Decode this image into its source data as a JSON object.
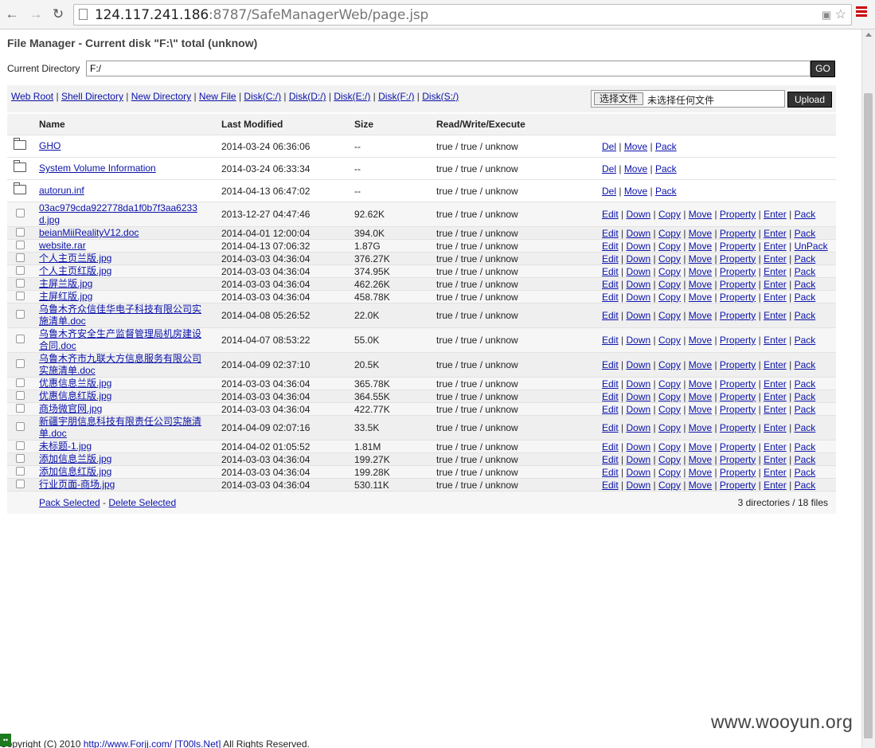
{
  "browser": {
    "url_host": "124.117.241.186",
    "url_rest": ":8787/SafeManagerWeb/page.jsp"
  },
  "page": {
    "title": "File Manager - Current disk \"F:\\\" total (unknow)",
    "current_directory_label": "Current Directory",
    "current_directory_value": "F:/",
    "go_label": "GO",
    "nav_links": [
      "Web Root",
      "Shell Directory",
      "New Directory",
      "New File",
      "Disk(C:/)",
      "Disk(D:/)",
      "Disk(E:/)",
      "Disk(F:/)",
      "Disk(S:/)"
    ],
    "choose_file_label": "选择文件",
    "no_file_label": "未选择任何文件",
    "upload_label": "Upload",
    "columns": [
      "Name",
      "Last Modified",
      "Size",
      "Read/Write/Execute"
    ],
    "directories": [
      {
        "name": "GHO",
        "modified": "2014-03-24 06:36:06",
        "size": "--",
        "rwx": "true / true / unknow",
        "actions": [
          "Del",
          "Move",
          "Pack"
        ]
      },
      {
        "name": "System Volume Information",
        "modified": "2014-03-24 06:33:34",
        "size": "--",
        "rwx": "true / true / unknow",
        "actions": [
          "Del",
          "Move",
          "Pack"
        ]
      },
      {
        "name": "autorun.inf",
        "modified": "2014-04-13 06:47:02",
        "size": "--",
        "rwx": "true / true / unknow",
        "actions": [
          "Del",
          "Move",
          "Pack"
        ]
      }
    ],
    "files": [
      {
        "name": "03ac979cda922778da1f0b7f3aa6233d.jpg",
        "modified": "2013-12-27 04:47:46",
        "size": "92.62K",
        "rwx": "true / true / unknow",
        "actions": [
          "Edit",
          "Down",
          "Copy",
          "Move",
          "Property",
          "Enter",
          "Pack"
        ]
      },
      {
        "name": "beianMiiRealityV12.doc",
        "modified": "2014-04-01 12:00:04",
        "size": "394.0K",
        "rwx": "true / true / unknow",
        "actions": [
          "Edit",
          "Down",
          "Copy",
          "Move",
          "Property",
          "Enter",
          "Pack"
        ]
      },
      {
        "name": "website.rar",
        "modified": "2014-04-13 07:06:32",
        "size": "1.87G",
        "rwx": "true / true / unknow",
        "actions": [
          "Edit",
          "Down",
          "Copy",
          "Move",
          "Property",
          "Enter",
          "UnPack"
        ]
      },
      {
        "name": "个人主页兰版.jpg",
        "modified": "2014-03-03 04:36:04",
        "size": "376.27K",
        "rwx": "true / true / unknow",
        "actions": [
          "Edit",
          "Down",
          "Copy",
          "Move",
          "Property",
          "Enter",
          "Pack"
        ]
      },
      {
        "name": "个人主页红版.jpg",
        "modified": "2014-03-03 04:36:04",
        "size": "374.95K",
        "rwx": "true / true / unknow",
        "actions": [
          "Edit",
          "Down",
          "Copy",
          "Move",
          "Property",
          "Enter",
          "Pack"
        ]
      },
      {
        "name": "主屏兰版.jpg",
        "modified": "2014-03-03 04:36:04",
        "size": "462.26K",
        "rwx": "true / true / unknow",
        "actions": [
          "Edit",
          "Down",
          "Copy",
          "Move",
          "Property",
          "Enter",
          "Pack"
        ]
      },
      {
        "name": "主屏红版.jpg",
        "modified": "2014-03-03 04:36:04",
        "size": "458.78K",
        "rwx": "true / true / unknow",
        "actions": [
          "Edit",
          "Down",
          "Copy",
          "Move",
          "Property",
          "Enter",
          "Pack"
        ]
      },
      {
        "name": "乌鲁木齐众信佳华电子科技有限公司实施清单.doc",
        "modified": "2014-04-08 05:26:52",
        "size": "22.0K",
        "rwx": "true / true / unknow",
        "actions": [
          "Edit",
          "Down",
          "Copy",
          "Move",
          "Property",
          "Enter",
          "Pack"
        ]
      },
      {
        "name": "乌鲁木齐安全生产监督管理局机房建设合同.doc",
        "modified": "2014-04-07 08:53:22",
        "size": "55.0K",
        "rwx": "true / true / unknow",
        "actions": [
          "Edit",
          "Down",
          "Copy",
          "Move",
          "Property",
          "Enter",
          "Pack"
        ]
      },
      {
        "name": "乌鲁木齐市九联大方信息服务有限公司实施清单.doc",
        "modified": "2014-04-09 02:37:10",
        "size": "20.5K",
        "rwx": "true / true / unknow",
        "actions": [
          "Edit",
          "Down",
          "Copy",
          "Move",
          "Property",
          "Enter",
          "Pack"
        ]
      },
      {
        "name": "优惠信息兰版.jpg",
        "modified": "2014-03-03 04:36:04",
        "size": "365.78K",
        "rwx": "true / true / unknow",
        "actions": [
          "Edit",
          "Down",
          "Copy",
          "Move",
          "Property",
          "Enter",
          "Pack"
        ]
      },
      {
        "name": "优惠信息红版.jpg",
        "modified": "2014-03-03 04:36:04",
        "size": "364.55K",
        "rwx": "true / true / unknow",
        "actions": [
          "Edit",
          "Down",
          "Copy",
          "Move",
          "Property",
          "Enter",
          "Pack"
        ]
      },
      {
        "name": "商场微官网.jpg",
        "modified": "2014-03-03 04:36:04",
        "size": "422.77K",
        "rwx": "true / true / unknow",
        "actions": [
          "Edit",
          "Down",
          "Copy",
          "Move",
          "Property",
          "Enter",
          "Pack"
        ]
      },
      {
        "name": "新疆宇朋信息科技有限责任公司实施清单.doc",
        "modified": "2014-04-09 02:07:16",
        "size": "33.5K",
        "rwx": "true / true / unknow",
        "actions": [
          "Edit",
          "Down",
          "Copy",
          "Move",
          "Property",
          "Enter",
          "Pack"
        ]
      },
      {
        "name": "未标题-1.jpg",
        "modified": "2014-04-02 01:05:52",
        "size": "1.81M",
        "rwx": "true / true / unknow",
        "actions": [
          "Edit",
          "Down",
          "Copy",
          "Move",
          "Property",
          "Enter",
          "Pack"
        ]
      },
      {
        "name": "添加信息兰版.jpg",
        "modified": "2014-03-03 04:36:04",
        "size": "199.27K",
        "rwx": "true / true / unknow",
        "actions": [
          "Edit",
          "Down",
          "Copy",
          "Move",
          "Property",
          "Enter",
          "Pack"
        ]
      },
      {
        "name": "添加信息红版.jpg",
        "modified": "2014-03-03 04:36:04",
        "size": "199.28K",
        "rwx": "true / true / unknow",
        "actions": [
          "Edit",
          "Down",
          "Copy",
          "Move",
          "Property",
          "Enter",
          "Pack"
        ]
      },
      {
        "name": "行业页面-商场.jpg",
        "modified": "2014-03-03 04:36:04",
        "size": "530.11K",
        "rwx": "true / true / unknow",
        "actions": [
          "Edit",
          "Down",
          "Copy",
          "Move",
          "Property",
          "Enter",
          "Pack"
        ]
      }
    ],
    "pack_selected_label": "Pack Selected",
    "delete_selected_label": "Delete Selected",
    "count_text": "3 directories / 18 files",
    "copyright_prefix": "Copyright (C) 2010 ",
    "copyright_link1": "http://www.Forjj.com/",
    "copyright_link2": "[T00ls.Net]",
    "copyright_suffix": " All Rights Reserved."
  },
  "watermark": "www.wooyun.org",
  "icons": [
    "back-arrow-icon",
    "forward-arrow-icon",
    "reload-icon",
    "page-icon",
    "translate-icon",
    "star-icon",
    "menu-icon",
    "folder-icon"
  ]
}
